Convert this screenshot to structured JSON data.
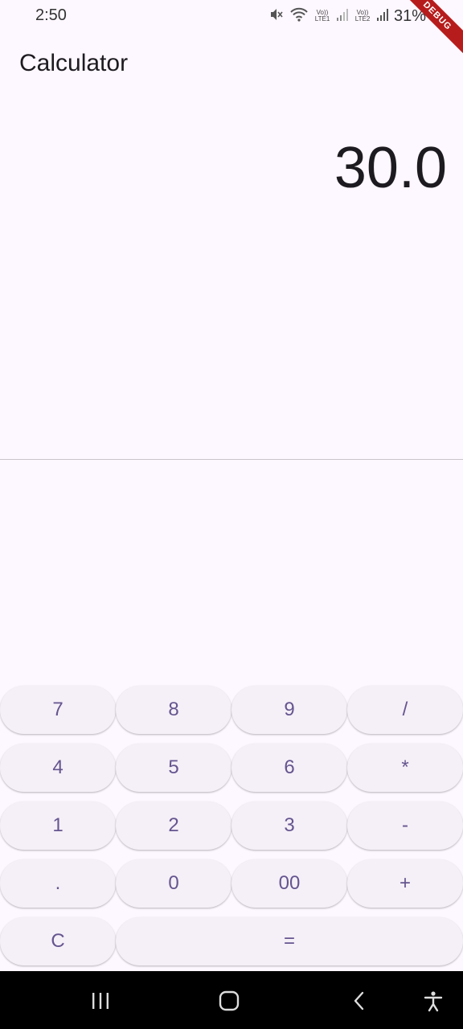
{
  "status_bar": {
    "time": "2:50",
    "sim1_label": "Vo)) LTE1",
    "sim2_label": "Vo)) LTE2",
    "battery": "31%"
  },
  "debug_banner": "DEBUG",
  "app": {
    "title": "Calculator"
  },
  "display": {
    "value": "30.0"
  },
  "keypad": {
    "keys": [
      "7",
      "8",
      "9",
      "/",
      "4",
      "5",
      "6",
      "*",
      "1",
      "2",
      "3",
      "-",
      ".",
      "0",
      "00",
      "+",
      "C",
      "="
    ]
  },
  "colors": {
    "background": "#fdf7ff",
    "key_background": "#f5eff7",
    "key_text": "#65558f",
    "display_text": "#1d1b20",
    "nav_bar": "#000000"
  }
}
